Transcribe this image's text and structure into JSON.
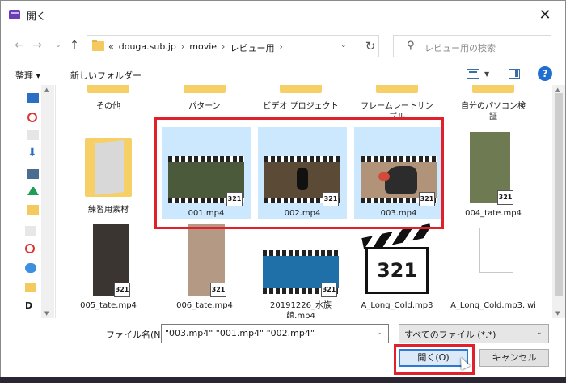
{
  "window": {
    "title": "開く",
    "close_glyph": "✕"
  },
  "address": {
    "back_glyph": "←",
    "forward_glyph": "→",
    "recent_glyph": "⌄",
    "up_glyph": "↑",
    "prefix": "«",
    "breadcrumbs": [
      "douga.sub.jp",
      "movie",
      "レビュー用"
    ],
    "separator": "›",
    "dropdown_glyph": "⌄",
    "refresh_glyph": "↻"
  },
  "search": {
    "placeholder": "レビュー用の検索",
    "icon_glyph": "⚲"
  },
  "toolbar": {
    "organize": "整理 ▾",
    "new_folder": "新しいフォルダー",
    "view_dd_glyph": "▼",
    "help_glyph": "?"
  },
  "files": {
    "row1": [
      "その他",
      "パターン",
      "ビデオ プロジェクト",
      "フレームレートサンプル",
      "自分のパソコン検証"
    ],
    "row2": [
      {
        "label": "練習用素材",
        "kind": "folder"
      },
      {
        "label": "001.mp4",
        "kind": "video",
        "selected": true
      },
      {
        "label": "002.mp4",
        "kind": "video",
        "selected": true
      },
      {
        "label": "003.mp4",
        "kind": "video",
        "selected": true
      },
      {
        "label": "004_tate.mp4",
        "kind": "video"
      }
    ],
    "row3": [
      {
        "label": "005_tate.mp4",
        "kind": "video"
      },
      {
        "label": "006_tate.mp4",
        "kind": "video"
      },
      {
        "label": "20191226_水族館.mp4",
        "kind": "video"
      },
      {
        "label": "A_Long_Cold.mp3",
        "kind": "audio"
      },
      {
        "label": "A_Long_Cold.mp3.lwi",
        "kind": "file"
      }
    ],
    "badge_text": "321"
  },
  "bottom": {
    "filename_label": "ファイル名(N):",
    "filename_value": "\"003.mp4\" \"001.mp4\" \"002.mp4\"",
    "filetype_value": "すべてのファイル (*.*)",
    "dropdown_glyph": "⌄",
    "open_label": "開く(O)",
    "cancel_label": "キャンセル"
  },
  "colors": {
    "selection": "#cce8ff",
    "highlight_box": "#e0202a",
    "folder": "#f6d067",
    "accent": "#2a7ad6"
  }
}
